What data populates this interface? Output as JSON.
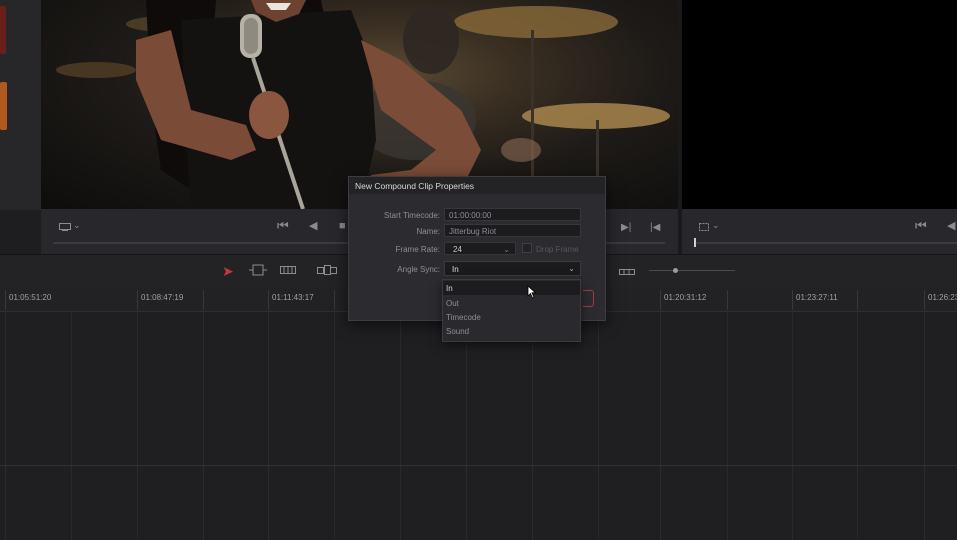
{
  "viewer": {
    "source_transport": {
      "icons": [
        "monitor-icon",
        "chevron-down-icon",
        "skip-to-start-icon",
        "play-reverse-icon",
        "stop-icon",
        "next-frame-icon",
        "skip-to-end-icon"
      ]
    },
    "program_transport": {
      "icons": [
        "crop-frame-icon",
        "chevron-down-icon",
        "skip-to-start-icon",
        "play-reverse-icon"
      ]
    }
  },
  "toolbar": {
    "active_tool_color": "#c23a3a"
  },
  "timeline": {
    "ruler_timecodes": [
      "01:05:51:20",
      "01:08:47:19",
      "01:11:43:17",
      "01:20:31:12",
      "01:23:27:11",
      "01:26:23"
    ]
  },
  "dialog": {
    "title": "New Compound Clip Properties",
    "start_timecode_label": "Start Timecode:",
    "start_timecode_value": "01:00:00:00",
    "name_label": "Name:",
    "name_value": "Jitterbug Riot",
    "frame_rate_label": "Frame Rate:",
    "frame_rate_value": "24",
    "drop_frame_label": "Drop Frame",
    "angle_sync_label": "Angle Sync:",
    "angle_sync_value": "In"
  },
  "dropdown": {
    "options": [
      "In",
      "Out",
      "Timecode",
      "Sound"
    ],
    "selected": "In"
  }
}
